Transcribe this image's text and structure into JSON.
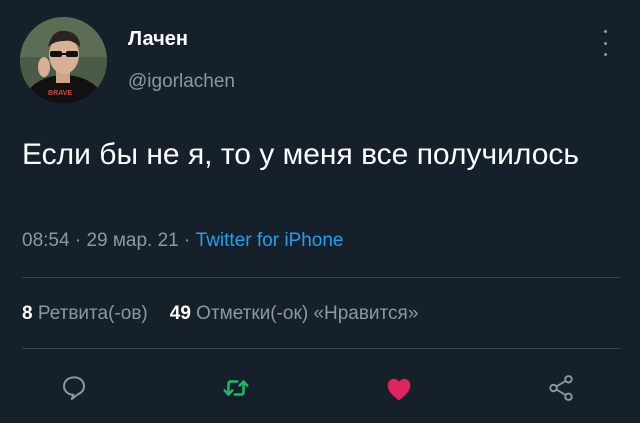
{
  "user": {
    "display_name": "Лачен",
    "handle": "@igorlachen",
    "avatar_icon": "profile-photo"
  },
  "tweet": {
    "text": "Если бы не я, то у меня все получилось",
    "time": "08:54",
    "separator1": " · ",
    "date": "29 мар. 21",
    "separator2": " · ",
    "source": "Twitter for iPhone"
  },
  "stats": {
    "retweets_count": "8",
    "retweets_label": "Ретвита(-ов)",
    "likes_count": "49",
    "likes_label": "Отметки(-ок) «Нравится»"
  },
  "actions": {
    "reply_icon": "comment-icon",
    "retweet_icon": "retweet-icon",
    "like_icon": "heart-icon",
    "share_icon": "share-icon"
  },
  "colors": {
    "background": "#15202b",
    "secondary_text": "#8899a6",
    "link": "#1da1f2",
    "retweet_green": "#17bf63",
    "like_pink": "#e0245e"
  }
}
